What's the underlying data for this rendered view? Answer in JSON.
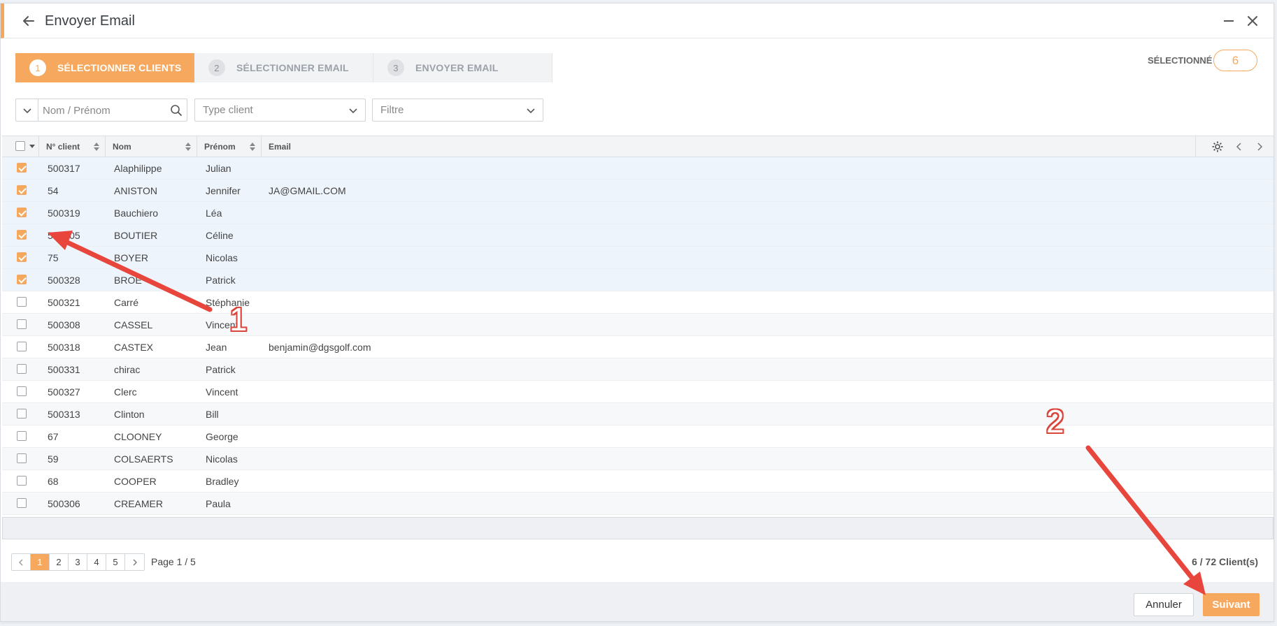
{
  "window": {
    "title": "Envoyer Email"
  },
  "steps": [
    {
      "num": "1",
      "label": "SÉLECTIONNER CLIENTS",
      "active": true
    },
    {
      "num": "2",
      "label": "SÉLECTIONNER EMAIL",
      "active": false
    },
    {
      "num": "3",
      "label": "ENVOYER EMAIL",
      "active": false
    }
  ],
  "selection": {
    "label": "SÉLECTIONNÉ",
    "count": "6"
  },
  "filters": {
    "name_placeholder": "Nom / Prénom",
    "type_client": "Type client",
    "filtre": "Filtre"
  },
  "columns": [
    "N° client",
    "Nom",
    "Prénom",
    "Email"
  ],
  "rows": [
    {
      "num": "500317",
      "nom": "Alaphilippe",
      "prenom": "Julian",
      "email": "",
      "checked": true
    },
    {
      "num": "54",
      "nom": "ANISTON",
      "prenom": "Jennifer",
      "email": "JA@GMAIL.COM",
      "checked": true
    },
    {
      "num": "500319",
      "nom": "Bauchiero",
      "prenom": "Léa",
      "email": "",
      "checked": true
    },
    {
      "num": "500305",
      "nom": "BOUTIER",
      "prenom": "Céline",
      "email": "",
      "checked": true
    },
    {
      "num": "75",
      "nom": "BOYER",
      "prenom": "Nicolas",
      "email": "",
      "checked": true
    },
    {
      "num": "500328",
      "nom": "BROE",
      "prenom": "Patrick",
      "email": "",
      "checked": true
    },
    {
      "num": "500321",
      "nom": "Carré",
      "prenom": "Stéphanie",
      "email": "",
      "checked": false
    },
    {
      "num": "500308",
      "nom": "CASSEL",
      "prenom": "Vincent",
      "email": "",
      "checked": false
    },
    {
      "num": "500318",
      "nom": "CASTEX",
      "prenom": "Jean",
      "email": "benjamin@dgsgolf.com",
      "checked": false
    },
    {
      "num": "500331",
      "nom": "chirac",
      "prenom": "Patrick",
      "email": "",
      "checked": false
    },
    {
      "num": "500327",
      "nom": "Clerc",
      "prenom": "Vincent",
      "email": "",
      "checked": false
    },
    {
      "num": "500313",
      "nom": "Clinton",
      "prenom": "Bill",
      "email": "",
      "checked": false
    },
    {
      "num": "67",
      "nom": "CLOONEY",
      "prenom": "George",
      "email": "",
      "checked": false
    },
    {
      "num": "59",
      "nom": "COLSAERTS",
      "prenom": "Nicolas",
      "email": "",
      "checked": false
    },
    {
      "num": "68",
      "nom": "COOPER",
      "prenom": "Bradley",
      "email": "",
      "checked": false
    },
    {
      "num": "500306",
      "nom": "CREAMER",
      "prenom": "Paula",
      "email": "",
      "checked": false
    }
  ],
  "pagination": {
    "pages": [
      "1",
      "2",
      "3",
      "4",
      "5"
    ],
    "current": "1",
    "page_info": "Page 1 / 5",
    "count_info": "6 / 72 Client(s)"
  },
  "buttons": {
    "cancel": "Annuler",
    "next": "Suivant"
  },
  "annotations": {
    "one": "1",
    "two": "2"
  },
  "colors": {
    "accent": "#f6a95e",
    "arrow": "#e8453c"
  }
}
